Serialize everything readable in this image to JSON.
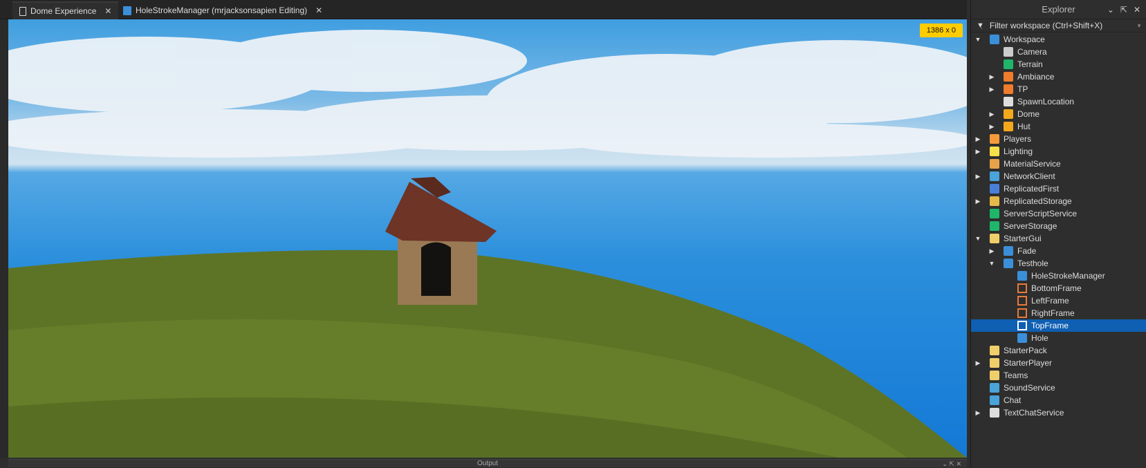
{
  "tabs": [
    {
      "label": "Dome Experience",
      "icon": "place-file-icon",
      "active": true
    },
    {
      "label": "HoleStrokeManager (mrjacksonsapien Editing)",
      "icon": "local-script-icon",
      "active": false
    }
  ],
  "viewport": {
    "size_badge": "1386 x 0"
  },
  "output": {
    "title": "Output"
  },
  "explorer": {
    "title": "Explorer",
    "filter_placeholder": "Filter workspace (Ctrl+Shift+X)",
    "selected": "TopFrame",
    "items": [
      {
        "label": "Workspace",
        "level": 0,
        "arrow": "down",
        "color": "#3b8fd9"
      },
      {
        "label": "Camera",
        "level": 1,
        "arrow": "",
        "color": "#cccccc"
      },
      {
        "label": "Terrain",
        "level": 1,
        "arrow": "",
        "color": "#1fb56a"
      },
      {
        "label": "Ambiance",
        "level": 1,
        "arrow": "right",
        "color": "#f07b2c"
      },
      {
        "label": "TP",
        "level": 1,
        "arrow": "right",
        "color": "#f07b2c"
      },
      {
        "label": "SpawnLocation",
        "level": 1,
        "arrow": "",
        "color": "#dddddd"
      },
      {
        "label": "Dome",
        "level": 1,
        "arrow": "right",
        "color": "#f4a81c"
      },
      {
        "label": "Hut",
        "level": 1,
        "arrow": "right",
        "color": "#f4a81c"
      },
      {
        "label": "Players",
        "level": 0,
        "arrow": "right",
        "color": "#f49a3a"
      },
      {
        "label": "Lighting",
        "level": 0,
        "arrow": "right",
        "color": "#f5e04a"
      },
      {
        "label": "MaterialService",
        "level": 0,
        "arrow": "",
        "color": "#e6a24a"
      },
      {
        "label": "NetworkClient",
        "level": 0,
        "arrow": "right",
        "color": "#4aa3d9"
      },
      {
        "label": "ReplicatedFirst",
        "level": 0,
        "arrow": "",
        "color": "#4a7fd9"
      },
      {
        "label": "ReplicatedStorage",
        "level": 0,
        "arrow": "right",
        "color": "#e6b84a"
      },
      {
        "label": "ServerScriptService",
        "level": 0,
        "arrow": "",
        "color": "#1fb56a"
      },
      {
        "label": "ServerStorage",
        "level": 0,
        "arrow": "",
        "color": "#1fb56a"
      },
      {
        "label": "StarterGui",
        "level": 0,
        "arrow": "down",
        "color": "#f0cf6a"
      },
      {
        "label": "Fade",
        "level": 1,
        "arrow": "right",
        "color": "#3b8fd9"
      },
      {
        "label": "Testhole",
        "level": 1,
        "arrow": "down",
        "color": "#3b8fd9"
      },
      {
        "label": "HoleStrokeManager",
        "level": 2,
        "arrow": "",
        "color": "#3b8fd9"
      },
      {
        "label": "BottomFrame",
        "level": 2,
        "arrow": "",
        "color": "#e87a3a"
      },
      {
        "label": "LeftFrame",
        "level": 2,
        "arrow": "",
        "color": "#e87a3a"
      },
      {
        "label": "RightFrame",
        "level": 2,
        "arrow": "",
        "color": "#e87a3a"
      },
      {
        "label": "TopFrame",
        "level": 2,
        "arrow": "",
        "color": "#ffffff"
      },
      {
        "label": "Hole",
        "level": 2,
        "arrow": "",
        "color": "#3b8fd9"
      },
      {
        "label": "StarterPack",
        "level": 0,
        "arrow": "",
        "color": "#f0cf6a"
      },
      {
        "label": "StarterPlayer",
        "level": 0,
        "arrow": "right",
        "color": "#f0cf6a"
      },
      {
        "label": "Teams",
        "level": 0,
        "arrow": "",
        "color": "#f0cf6a"
      },
      {
        "label": "SoundService",
        "level": 0,
        "arrow": "",
        "color": "#4aa3d9"
      },
      {
        "label": "Chat",
        "level": 0,
        "arrow": "",
        "color": "#4aa3d9"
      },
      {
        "label": "TextChatService",
        "level": 0,
        "arrow": "right",
        "color": "#dddddd"
      }
    ]
  }
}
